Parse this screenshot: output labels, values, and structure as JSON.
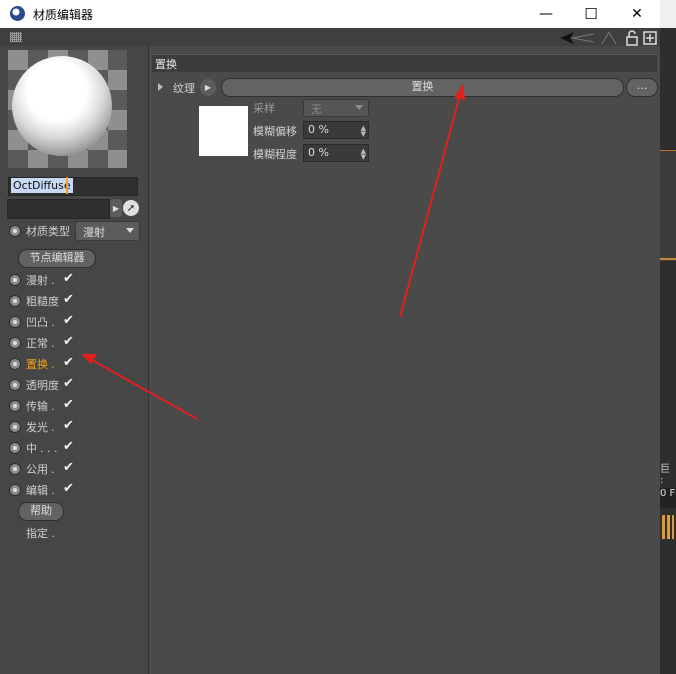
{
  "window": {
    "title": "材质编辑器",
    "minimize_glyph": "—",
    "maximize_glyph": "☐",
    "close_glyph": "✕"
  },
  "toolbar": {
    "icons": [
      "grip-icon",
      "back-arrow-icon",
      "lock-icon",
      "add-panel-icon"
    ]
  },
  "material": {
    "name": "OctDiffuse",
    "type_label": "材质类型",
    "type_value": "漫射",
    "node_editor_button": "节点编辑器"
  },
  "channels": [
    {
      "label": "漫射",
      "dots": ".",
      "checked": true,
      "active": false
    },
    {
      "label": "粗糙度",
      "dots": "",
      "checked": true,
      "active": false
    },
    {
      "label": "凹凸",
      "dots": ".",
      "checked": true,
      "active": false
    },
    {
      "label": "正常",
      "dots": ".",
      "checked": true,
      "active": false
    },
    {
      "label": "置换",
      "dots": ".",
      "checked": true,
      "active": true
    },
    {
      "label": "透明度",
      "dots": "",
      "checked": true,
      "active": false
    },
    {
      "label": "传输",
      "dots": ".",
      "checked": true,
      "active": false
    },
    {
      "label": "发光",
      "dots": ".",
      "checked": true,
      "active": false
    },
    {
      "label": "中",
      "dots": ". . .",
      "checked": true,
      "active": false
    },
    {
      "label": "公用",
      "dots": ".",
      "checked": true,
      "active": false
    },
    {
      "label": "编辑",
      "dots": ".",
      "checked": true,
      "active": false
    }
  ],
  "check_glyph": "✔",
  "help_button": "帮助",
  "assign_label": "指定",
  "assign_dots": ".",
  "section": {
    "title": "置换",
    "texture_label": "纹理",
    "texture_button": "置换",
    "more_button": "...",
    "sampling_label": "采样",
    "sampling_value": "无",
    "blur_offset_label": "模糊偏移",
    "blur_offset_value": "0 %",
    "blur_scale_label": "模糊程度",
    "blur_scale_value": "0 %"
  },
  "desktop_edge": {
    "fragment_top": "巨 :",
    "fragment_bottom": "0 F"
  },
  "colors": {
    "accent_orange": "#f0a21e",
    "annotation_red": "#e02020",
    "panel_bg": "#4a4a4a"
  }
}
